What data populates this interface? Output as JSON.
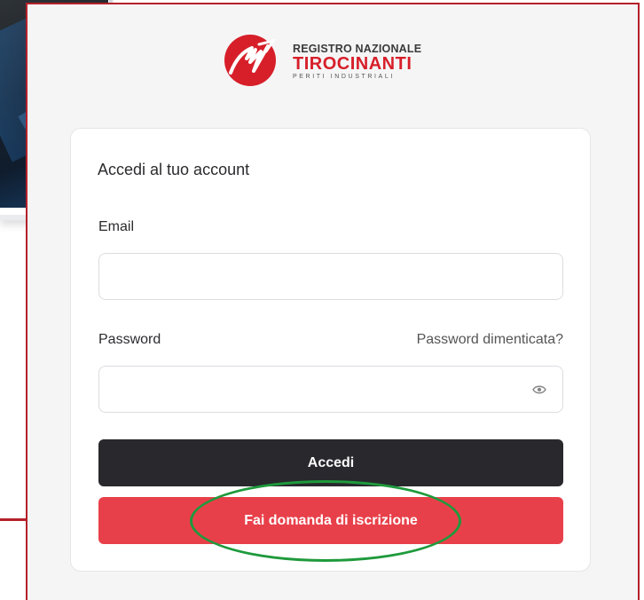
{
  "logo": {
    "line1": "REGISTRO NAZIONALE",
    "line2": "TIROCINANTI",
    "line3": "PERITI INDUSTRIALI"
  },
  "login": {
    "title": "Accedi al tuo account",
    "email_label": "Email",
    "email_value": "",
    "password_label": "Password",
    "password_value": "",
    "forgot_link": "Password dimenticata?",
    "submit_label": "Accedi",
    "apply_label": "Fai domanda di iscrizione"
  },
  "icons": {
    "password_toggle": "eye-icon"
  },
  "colors": {
    "brand_red": "#d71f2a",
    "apply_button": "#e8404a",
    "submit_button": "#28282d",
    "annotation_border": "#b5202a",
    "annotation_ellipse": "#1e9a3c"
  }
}
